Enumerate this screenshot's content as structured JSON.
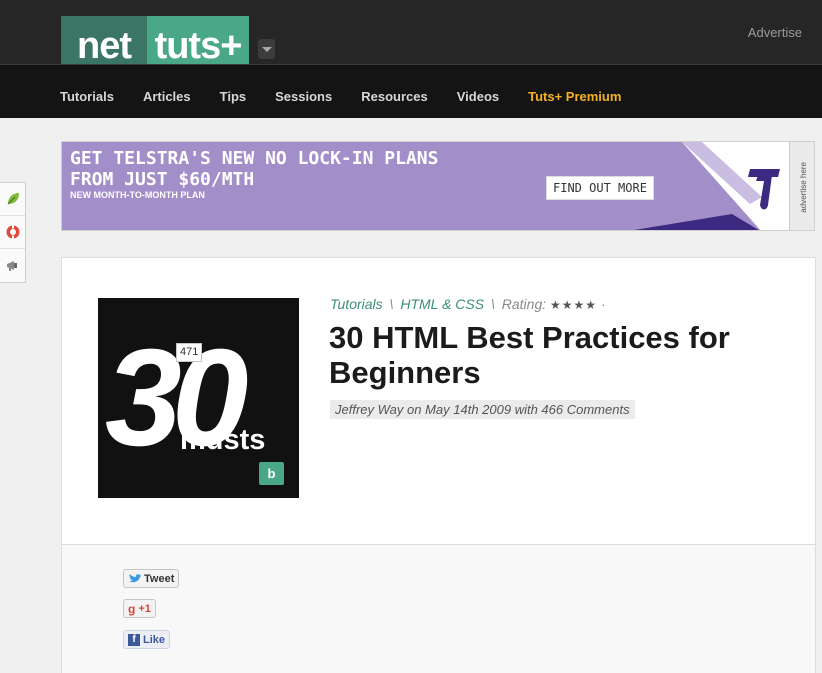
{
  "header": {
    "logo_left": "net",
    "logo_right": "tuts+",
    "advertise": "Advertise"
  },
  "nav": {
    "items": [
      "Tutorials",
      "Articles",
      "Tips",
      "Sessions",
      "Resources",
      "Videos",
      "Tuts+ Premium"
    ]
  },
  "banner": {
    "line1": "GET TELSTRA'S NEW NO LOCK-IN PLANS",
    "line2": "FROM JUST $60/MTH",
    "sub": "NEW MONTH-TO-MONTH PLAN",
    "cta": "FIND OUT MORE",
    "tag": "advertise here"
  },
  "article": {
    "thumb_number": "30",
    "thumb_word": "musts",
    "thumb_badge": "b",
    "category1": "Tutorials",
    "category2": "HTML & CSS",
    "sep": "\\",
    "rating_label": "Rating:",
    "rating_stars": "★★★★",
    "rating_dot": "·",
    "title": "30 HTML Best Practices for Beginners",
    "byline": "Jeffrey Way on May 14th 2009 with 466 Comments"
  },
  "social": {
    "tweet": "Tweet",
    "plusone": "+1",
    "like": "Like",
    "like_count": "471"
  },
  "colors": {
    "accent": "#4aa788",
    "premium": "#f4b223",
    "banner_bg": "#a28ec9"
  }
}
